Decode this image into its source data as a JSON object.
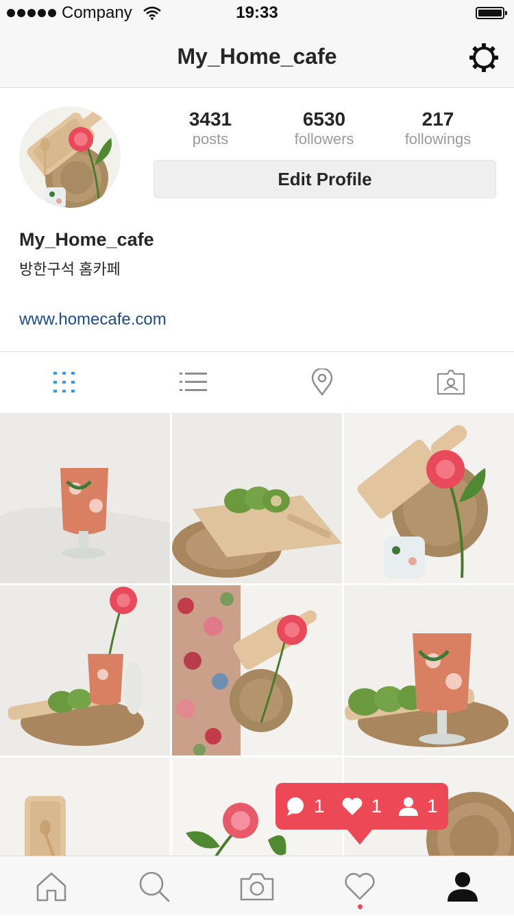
{
  "status_bar": {
    "carrier": "Company",
    "time": "19:33"
  },
  "nav": {
    "title": "My_Home_cafe",
    "settings_icon": "gear-icon"
  },
  "profile": {
    "stats": [
      {
        "value": "3431",
        "label": "posts"
      },
      {
        "value": "6530",
        "label": "followers"
      },
      {
        "value": "217",
        "label": "followings"
      }
    ],
    "edit_label": "Edit Profile",
    "username": "My_Home_cafe",
    "bio": "방한구석 홈카페",
    "website": "www.homecafe.com"
  },
  "view_tabs": [
    {
      "icon": "grid-icon",
      "active": true
    },
    {
      "icon": "list-icon",
      "active": false
    },
    {
      "icon": "location-pin-icon",
      "active": false
    },
    {
      "icon": "tagged-photos-icon",
      "active": false
    }
  ],
  "activity": {
    "comments": "1",
    "likes": "1",
    "follows": "1"
  },
  "bottom_tabs": [
    "home-icon",
    "search-icon",
    "camera-icon",
    "heart-icon",
    "profile-icon"
  ],
  "colors": {
    "accent": "#3897f0",
    "notification": "#ed4856",
    "link": "#1d4a84"
  }
}
